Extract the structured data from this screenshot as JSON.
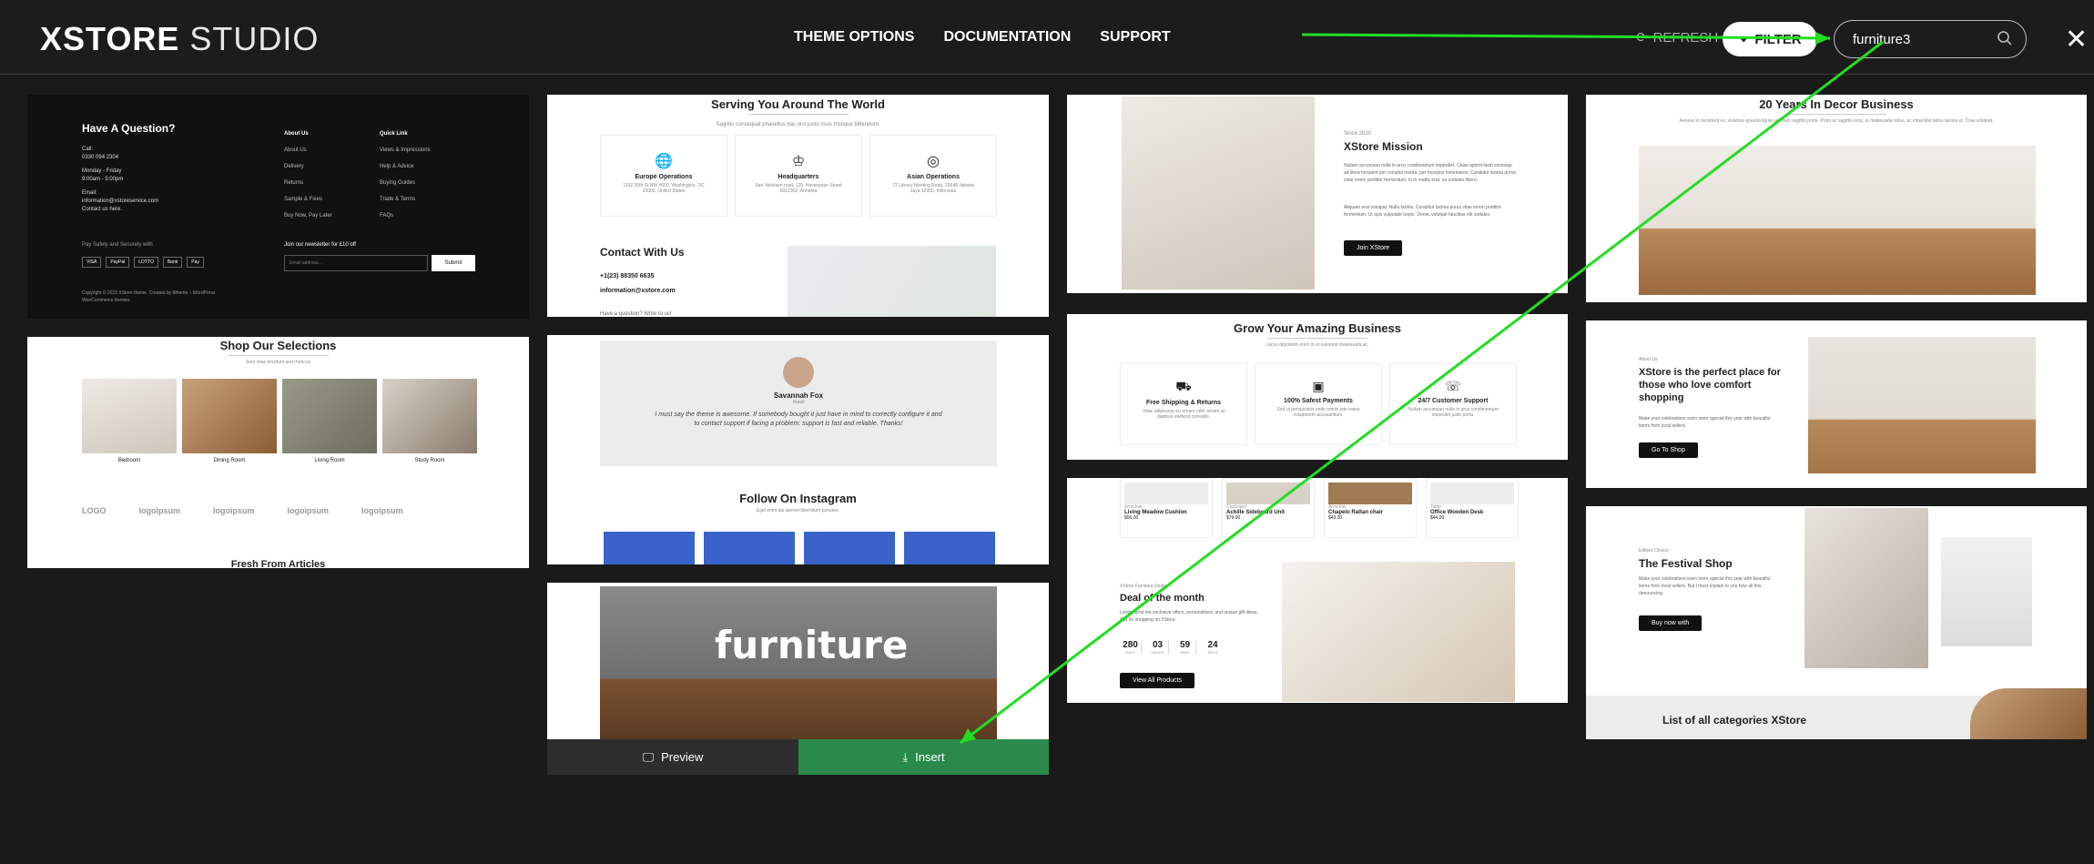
{
  "header": {
    "logo_bold": "XSTORE",
    "logo_light": "STUDIO",
    "nav": [
      "THEME OPTIONS",
      "DOCUMENTATION",
      "SUPPORT"
    ],
    "refresh_label": "REFRESH",
    "filter_label": "FILTER",
    "search_value": "furniture3"
  },
  "cards": {
    "footer": {
      "title": "Have A Question?",
      "call_label": "Call:",
      "phone": "0330 094 2304",
      "hours_days": "Monday - Friday",
      "hours": "9:00am - 5:00pm",
      "email_label": "Email:",
      "email": "information@xstoreservice.com",
      "contact_link": "Contact us here.",
      "col1_title": "About Us",
      "col1": [
        "About Us",
        "Delivery",
        "Returns",
        "Sample & Fixes",
        "Buy Now, Pay Later"
      ],
      "col2_title": "Quick Link",
      "col2": [
        "Views & Impressions",
        "Help & Advice",
        "Buying Guides",
        "Trade & Terms",
        "FAQs"
      ],
      "pay_label": "Pay Safely and Securely with",
      "pay_icons": [
        "VISA",
        "PayPal",
        "LOTTO",
        "Bank",
        "Pay"
      ],
      "newsletter": "Join our newsletter for £10 off",
      "email_placeholder": "Email address...",
      "submit": "Submit",
      "copyright": "Copyright © 2023 XStore theme. Created by 8theme – WordPress WooCommerce themes."
    },
    "serving": {
      "title": "Serving You Around The World",
      "subtitle": "Sagittis consequat phasellus hac orci justo risus tristique bibendum.",
      "offices": [
        {
          "name": "Europe Operations",
          "addr": "1102 35th St NW #600, Washington, DC 20005, United States"
        },
        {
          "name": "Headquarters",
          "addr": "Sari Yelekaim road, 125, Hovsepyan Street 0012302, Armenia"
        },
        {
          "name": "Asian Operations",
          "addr": "72 Library Meeting Road, 29648 Jakarta Jaya 12950, Indonesia"
        }
      ],
      "contact_title": "Contact With Us",
      "phone": "+1(23) 88350 6635",
      "email": "information@xstore.com",
      "question": "Have a question? Write to us!"
    },
    "mission": {
      "since": "Since 2010",
      "title": "XStore Mission",
      "p1": "Nullam accumsan nulla in arcu condimentum imperdiet. Class aptent taciti sociosqu ad litora torquent per conubia nostra, per inceptos himenaeos. Curabitur lacinia purus vitae lorem porttitor fermentum. In in mattis erat, eu sodales libero.",
      "p2": "Aliquam erat volutpat. Nulla facilisi. Curabitur lacinia purus vitae lorem porttitor fermentum. Ut quis vulputate turpis. Donec volutpat faucibus elit sodales.",
      "button": "Join XStore"
    },
    "decor": {
      "title": "20 Years In Decor Business",
      "subtitle": "Aenean in hendrerit ex, vivamus gravida ligula vel enim sagittis porta. Proin ac sagittis eros, ut malesuada tellus, ac imperdiet tellus lacinia ut. Cras volutpat."
    },
    "shop": {
      "title": "Shop Our Selections",
      "subtitle": "Sem vitae tincidunt and rhoncus",
      "cats": [
        "Bedroom",
        "Dining Room",
        "Living Room",
        "Study Room"
      ],
      "logos": [
        "LOGO",
        "logoipsum",
        "logoipsum",
        "logoipsum",
        "logoipsum"
      ],
      "footer_title": "Fresh From Articles"
    },
    "testimonial": {
      "name": "Savannah Fox",
      "role": "Retail",
      "quote": "I must say the theme is awesome. If somebody bought it just have in mind to correctly configure it and to contact support if facing a problem: support is fast and reliable. Thanks!",
      "insta_title": "Follow On Instagram",
      "insta_sub": "Eget enim dui laoreet bibendum posuere."
    },
    "grow": {
      "title": "Grow Your Amazing Business",
      "subtitle": "Lacus dignissim enim in ut euismod malesuada ac.",
      "features": [
        {
          "name": "Free Shipping & Returns",
          "desc": "Vitae adipiscing eu ornare nibh ornare at dapibus eleifend convallis."
        },
        {
          "name": "100% Safest Payments",
          "desc": "Sed ut perspiciatis unde omnis iste natus voluptatem accusantium."
        },
        {
          "name": "24/7 Customer Support",
          "desc": "Nullam accumsan nulla in arcu condimentum imperdiet justo porta."
        }
      ]
    },
    "about": {
      "eyebrow": "About Us",
      "title": "XStore is the perfect place for those who love comfort shopping",
      "desc": "Make your celebrations even more special this year with beautiful items from local sellers.",
      "button": "Go To Shop"
    },
    "furniture": {
      "banner": "furniture",
      "preview": "Preview",
      "insert": "Insert"
    },
    "deal": {
      "products": [
        {
          "cat": "Armchair",
          "name": "Living Meadow Cushion",
          "price": "$56.00"
        },
        {
          "cat": "Cupboard",
          "name": "Achille Sideboard Unit",
          "price": "$79.00"
        },
        {
          "cat": "Armchair",
          "name": "Chapelo Rattan chair",
          "price": "$43.00"
        },
        {
          "cat": "Table",
          "name": "Office Wooden Desk",
          "price": "$44.00"
        }
      ],
      "eyebrow": "XStore Furniture Deals",
      "title": "Deal of the month",
      "desc": "Lorem fiend me exclusive offers, personalized, and unique gift ideas. Opt for shopping on XStore.",
      "countdown": [
        {
          "v": "280",
          "l": "DAYS"
        },
        {
          "v": "03",
          "l": "HOURS"
        },
        {
          "v": "59",
          "l": "MINS"
        },
        {
          "v": "24",
          "l": "SECS"
        }
      ],
      "button": "View All Products"
    },
    "festival": {
      "eyebrow": "Editors Choice",
      "title": "The Festival Shop",
      "desc": "Make your celebrations even more special this year with beautiful items from local sellers. But I must explain to you how all this denouncing.",
      "button": "Buy now with",
      "footer": "List of all categories XStore"
    }
  },
  "colors": {
    "insert_green": "#2a8a4c",
    "annotation_green": "#22dd22",
    "page_bg": "#1a1a1a"
  }
}
